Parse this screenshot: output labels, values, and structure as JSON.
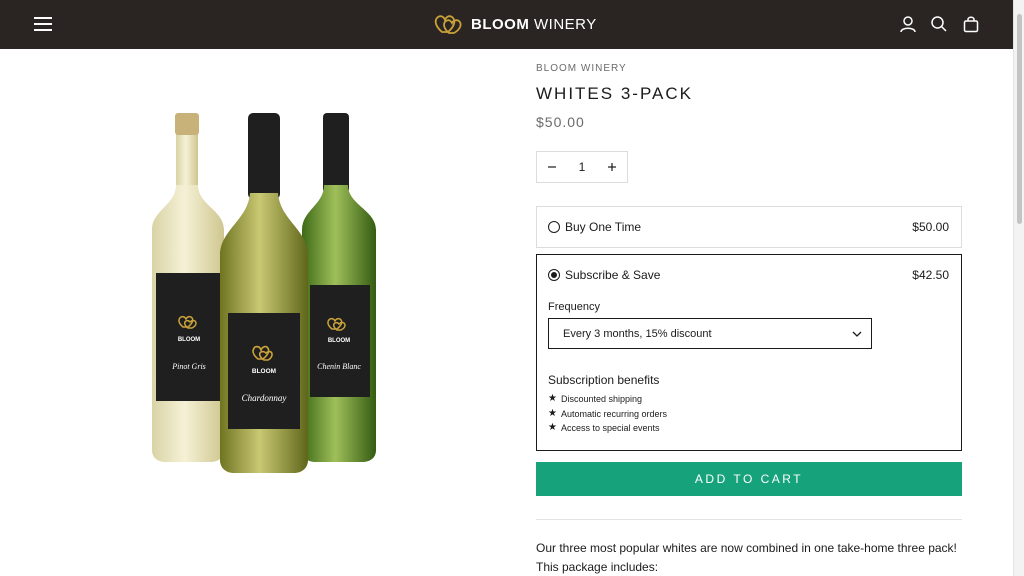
{
  "header": {
    "logo_bold": "BLOOM",
    "logo_light": "WINERY",
    "icons": [
      "menu-icon",
      "account-icon",
      "search-icon",
      "cart-icon"
    ]
  },
  "product": {
    "vendor": "BLOOM WINERY",
    "title": "WHITES 3-PACK",
    "price": "$50.00",
    "quantity": "1",
    "bottle_brand": "BLOOM",
    "bottles": [
      "Pinot Gris",
      "Chardonnay",
      "Chenin Blanc"
    ]
  },
  "purchase_options": {
    "one_time": {
      "label": "Buy One Time",
      "price": "$50.00",
      "selected": false
    },
    "subscribe": {
      "label": "Subscribe & Save",
      "price": "$42.50",
      "selected": true
    },
    "frequency_label": "Frequency",
    "frequency_value": "Every 3 months, 15% discount",
    "benefits_title": "Subscription benefits",
    "benefits": [
      "Discounted shipping",
      "Automatic recurring orders",
      "Access to special events"
    ]
  },
  "add_to_cart_label": "ADD TO CART",
  "description": "Our three most popular whites are now combined in one take-home three pack! This package includes:",
  "colors": {
    "header_bg": "#2a2523",
    "accent_gold": "#c9a23a",
    "cta_green": "#16a37b",
    "text": "#1c1b1b"
  }
}
